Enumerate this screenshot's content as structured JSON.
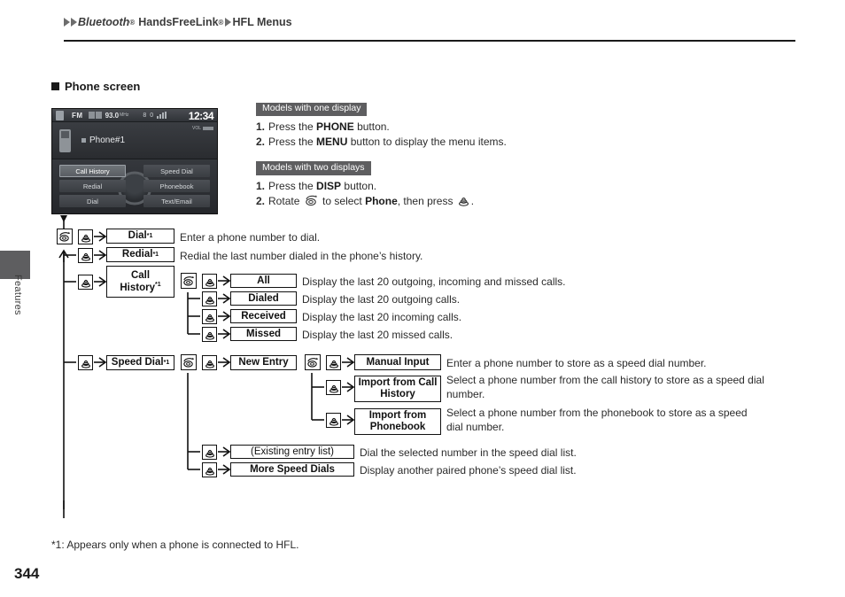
{
  "header": {
    "breadcrumb": {
      "item1": "Bluetooth",
      "sup1": "®",
      "item2": "HandsFreeLink",
      "sup2": "®",
      "item3": "HFL Menus"
    }
  },
  "side_tab": {
    "label": "Features"
  },
  "section": {
    "title": "Phone screen"
  },
  "device_screen": {
    "status": {
      "band": "FM",
      "frequency": "93.0",
      "frequency_unit": "MHz",
      "bluetooth": "8 0",
      "clock": "12:34"
    },
    "phone_label": "Phone#1",
    "volume": "VOL",
    "buttons_left": [
      "Call History",
      "Redial",
      "Dial"
    ],
    "buttons_right": [
      "Speed Dial",
      "Phonebook",
      "Text/Email"
    ],
    "selected_button": "Call History"
  },
  "instructions": {
    "group_one": {
      "badge": "Models with one display",
      "steps": [
        {
          "num": "1.",
          "pre": "Press the ",
          "bold": "PHONE",
          "post": " button."
        },
        {
          "num": "2.",
          "pre": "Press the ",
          "bold": "MENU",
          "post": " button to display the menu items."
        }
      ]
    },
    "group_two": {
      "badge": "Models with two displays",
      "steps": [
        {
          "num": "1.",
          "pre": "Press the ",
          "bold": "DISP",
          "post": " button."
        },
        {
          "num": "2.",
          "pre": "Rotate ",
          "bold": "Phone",
          "mid": " to select ",
          "post": ", then press "
        }
      ]
    }
  },
  "flow": {
    "nodes": {
      "dial": "Dial",
      "dial_sup": "*1",
      "redial": "Redial",
      "redial_sup": "*1",
      "call_history": "Call History",
      "call_history_sup": "*1",
      "all": "All",
      "dialed": "Dialed",
      "received": "Received",
      "missed": "Missed",
      "speed_dial": "Speed Dial",
      "speed_dial_sup": "*1",
      "new_entry": "New Entry",
      "manual_input": "Manual Input",
      "import_call_history": "Import from Call History",
      "import_phonebook": "Import from Phonebook",
      "existing_entry_list": "(Existing entry list)",
      "more_speed_dials": "More Speed Dials"
    },
    "descriptions": {
      "dial": "Enter a phone number to dial.",
      "redial": "Redial the last number dialed in the phone’s history.",
      "all": "Display the last 20 outgoing, incoming and missed calls.",
      "dialed": "Display the last 20 outgoing calls.",
      "received": "Display the last 20 incoming calls.",
      "missed": "Display the last 20 missed calls.",
      "manual_input": "Enter a phone number to store as a speed dial number.",
      "import_call_history": "Select a phone number from the call history to store as a speed dial number.",
      "import_phonebook": "Select a phone number from the phonebook to store as a speed dial number.",
      "existing_entry_list": "Dial the selected number in the speed dial list.",
      "more_speed_dials": "Display another paired phone’s speed dial list."
    }
  },
  "footnote": "*1: Appears only when a phone is connected to HFL.",
  "page_number": "344",
  "colors": {
    "badge_background": "#5e5e60",
    "text": "#231f20",
    "line": "#111111"
  }
}
